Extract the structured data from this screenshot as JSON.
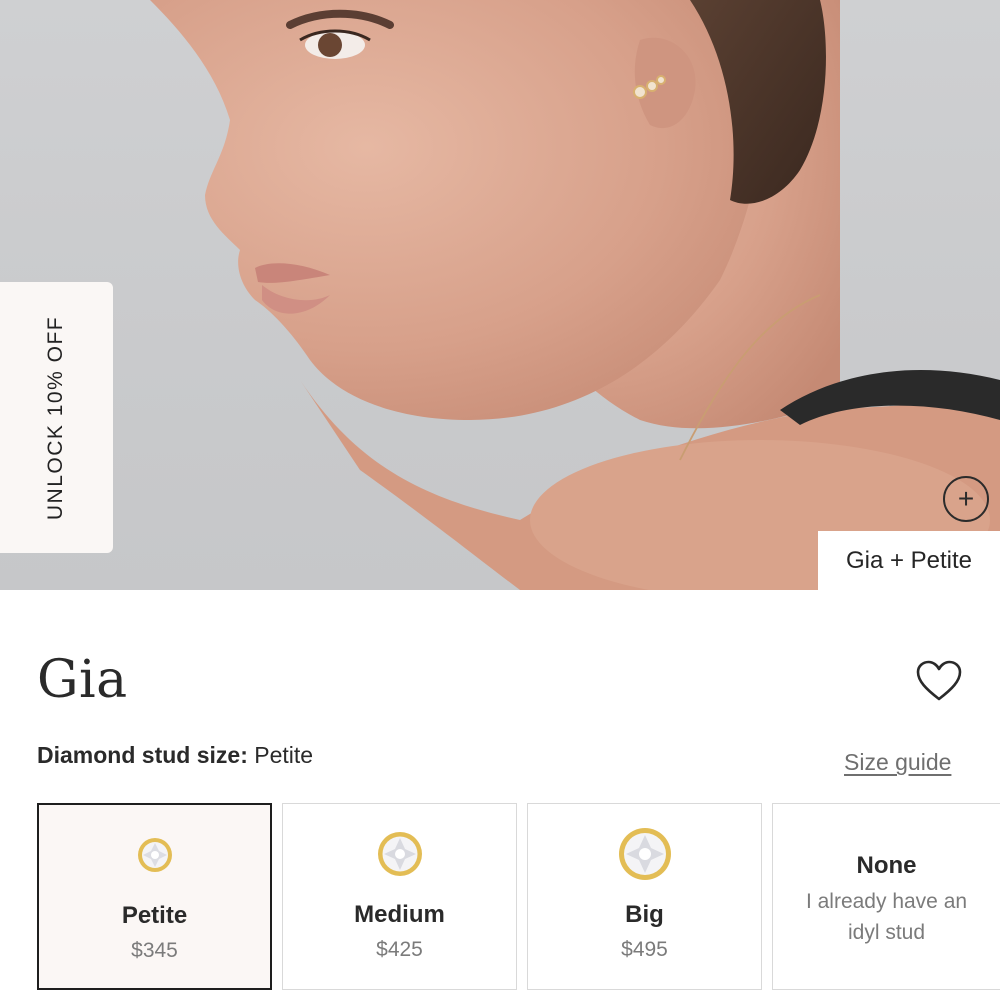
{
  "promo": {
    "tab_label": "UNLOCK 10% OFF"
  },
  "hero": {
    "hotspot_label": "Gia + Petite",
    "plus_symbol": "+"
  },
  "product": {
    "title": "Gia"
  },
  "size": {
    "label": "Diamond stud size:",
    "selected": "Petite",
    "guide_link": "Size guide"
  },
  "options": [
    {
      "name": "Petite",
      "price": "$345",
      "selected": true
    },
    {
      "name": "Medium",
      "price": "$425",
      "selected": false
    },
    {
      "name": "Big",
      "price": "$495",
      "selected": false
    },
    {
      "name": "None",
      "description": "I already have an idyl stud",
      "selected": false
    }
  ],
  "colors": {
    "gold": "#e3bd55",
    "selected_bg": "#fbf7f5",
    "selected_border": "#1e1e1e",
    "muted_text": "#7b7b7b"
  }
}
